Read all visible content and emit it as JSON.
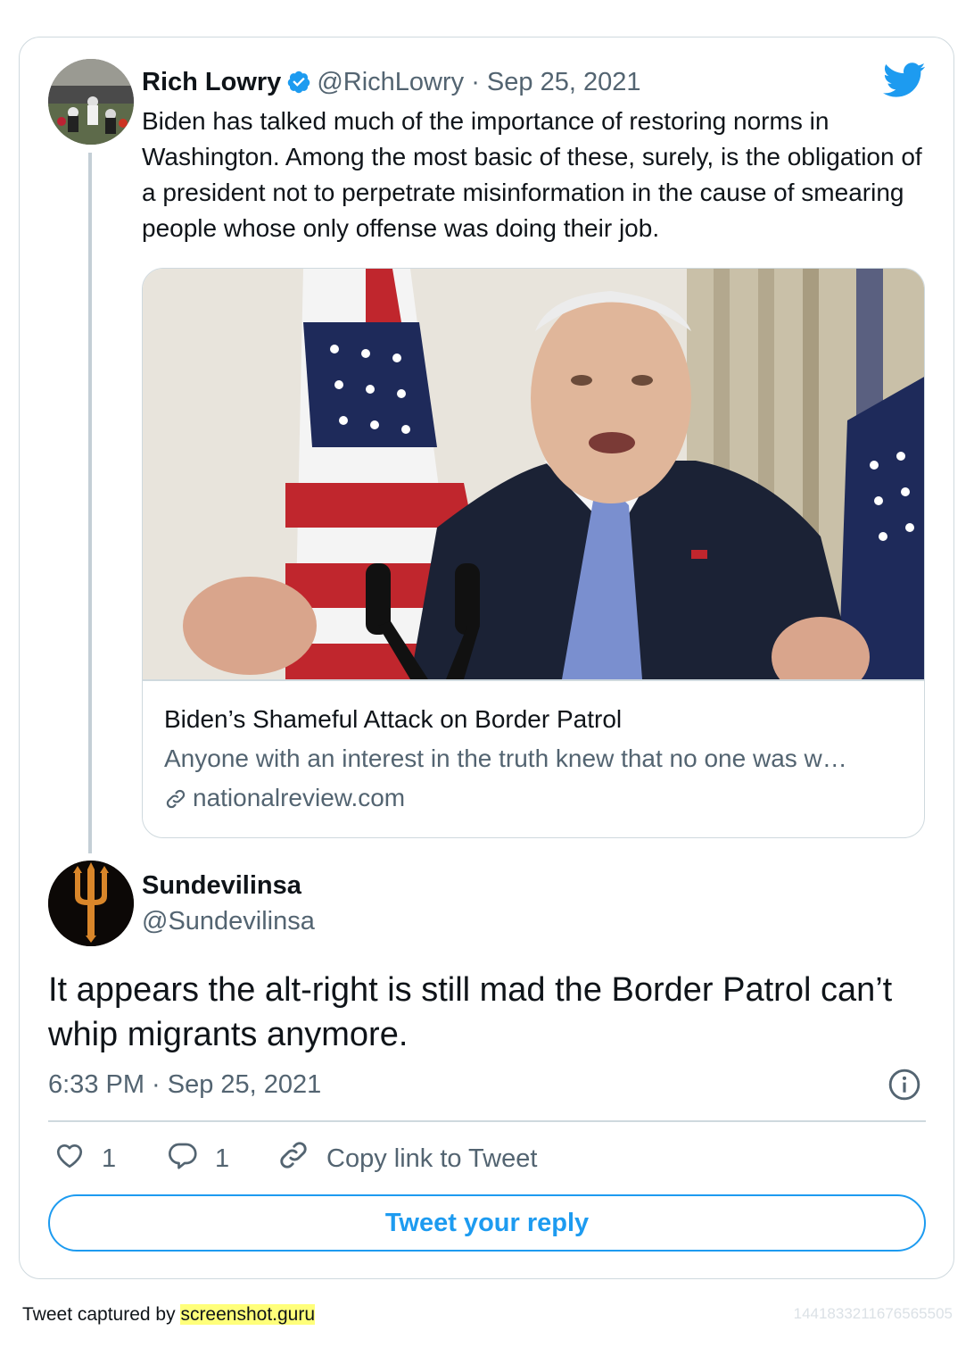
{
  "quoted_tweet": {
    "author_name": "Rich Lowry",
    "handle": "@RichLowry",
    "separator": "·",
    "date": "Sep 25, 2021",
    "text": "Biden has talked much of the importance of restoring norms in Washington. Among the most basic of these, surely, is the obligation of a president not to perpetrate misinformation in the cause of smearing people whose only offense was doing their job.",
    "link_card": {
      "title": "Biden’s Shameful Attack on Border Patrol",
      "description": "Anyone with an interest in the truth knew that no one was w…",
      "domain": "nationalreview.com"
    }
  },
  "reply_tweet": {
    "author_name": "Sundevilinsa",
    "handle": "@Sundevilinsa",
    "text": "It appears the alt-right is still mad the Border Patrol can’t whip migrants anymore.",
    "timestamp": "6:33 PM · Sep 25, 2021"
  },
  "actions": {
    "like_count": "1",
    "reply_count": "1",
    "copy_link_label": "Copy link to Tweet"
  },
  "reply_button_label": "Tweet your reply",
  "footer": {
    "captured_by_prefix": "Tweet captured by ",
    "captured_by_site": "screenshot.guru",
    "tweet_id": "1441833211676565505"
  },
  "colors": {
    "accent": "#1d9bf0",
    "secondary_text": "#536471",
    "border": "#cfd9de",
    "highlight": "#ffff7a"
  },
  "icons": [
    "verified-badge-icon",
    "twitter-bird-icon",
    "link-icon",
    "info-icon",
    "heart-icon",
    "reply-bubble-icon",
    "copy-link-icon"
  ]
}
